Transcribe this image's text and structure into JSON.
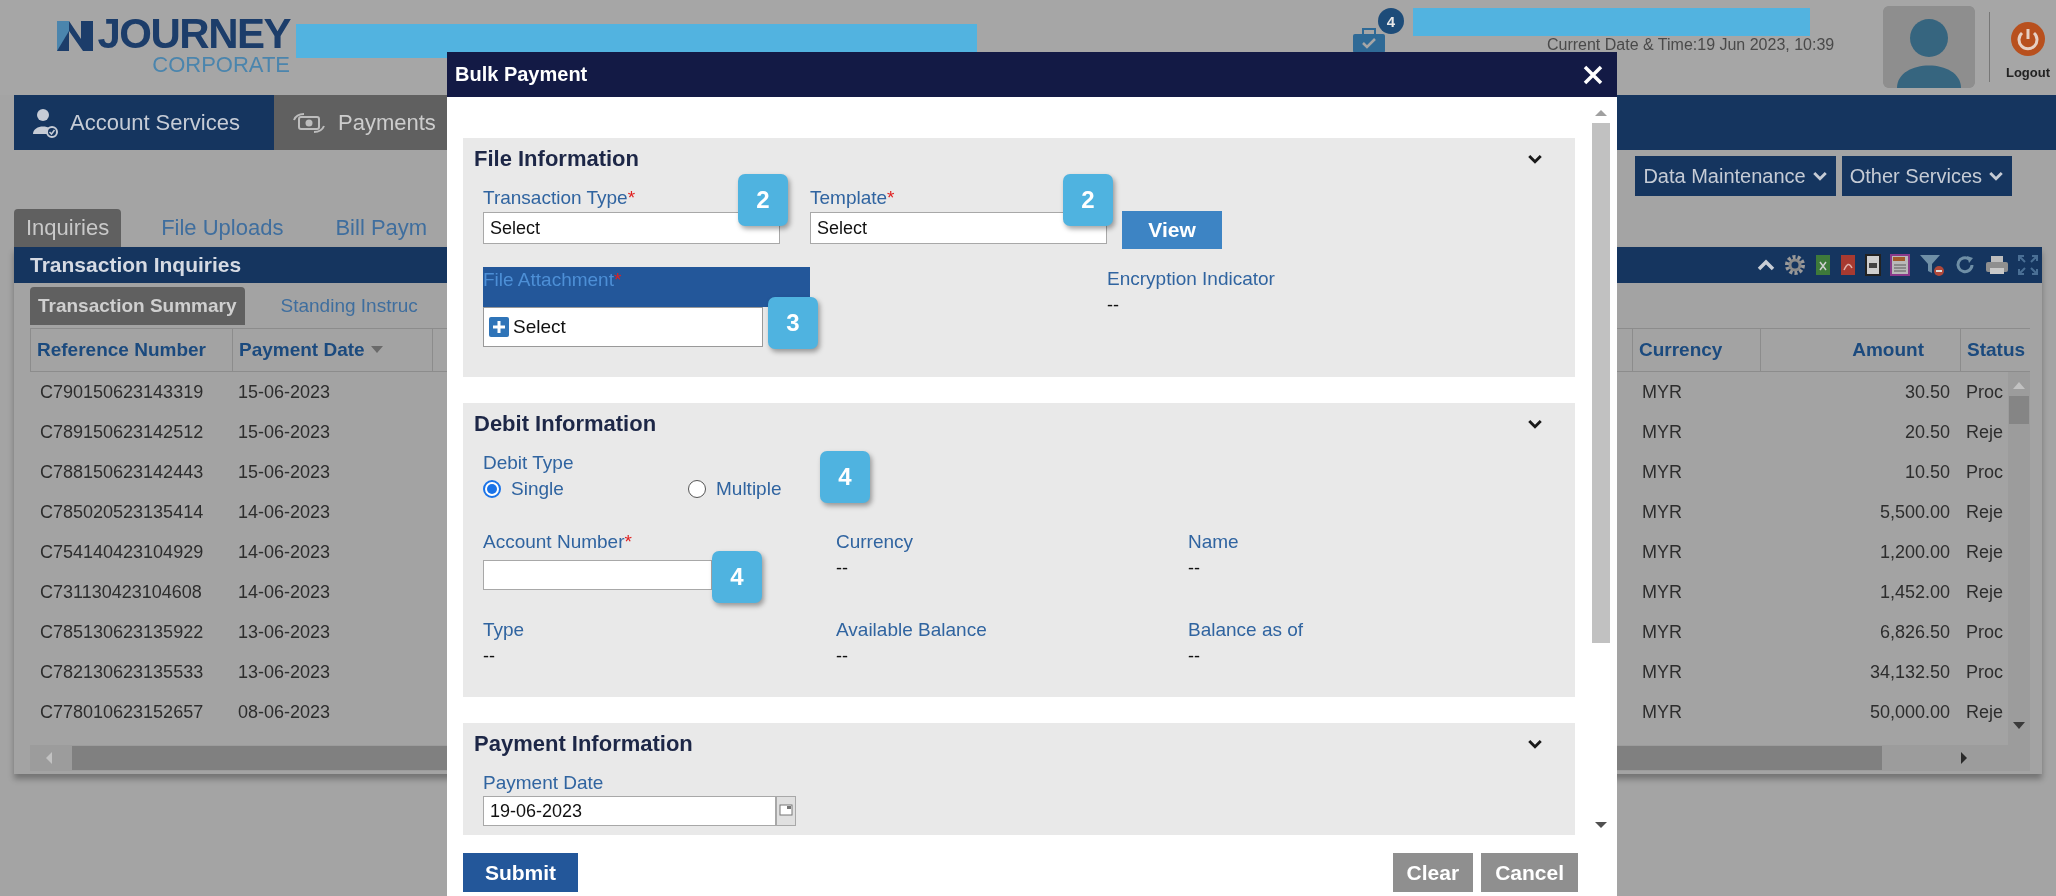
{
  "header": {
    "logo_name": "JOURNEY",
    "logo_tagline": "CORPORATE",
    "notification_count": "4",
    "datetime": "Current Date & Time:19 Jun 2023, 10:39",
    "logout": "Logout"
  },
  "nav": [
    {
      "label": "Account Services",
      "selected": false
    },
    {
      "label": "Payments",
      "selected": true
    }
  ],
  "menus": [
    {
      "label": "Data Maintenance"
    },
    {
      "label": "Other Services"
    }
  ],
  "tabs": [
    {
      "label": "Inquiries",
      "selected": true
    },
    {
      "label": "File Uploads",
      "selected": false
    },
    {
      "label": "Bill Paym",
      "selected": false
    }
  ],
  "panel": {
    "title": "Transaction Inquiries",
    "subtabs": [
      {
        "label": "Transaction Summary",
        "selected": true
      },
      {
        "label": "Standing Instruc",
        "selected": false
      }
    ],
    "table": {
      "columns": [
        {
          "label": "Reference Number",
          "sorted": false
        },
        {
          "label": "Payment Date",
          "sorted": true
        },
        {
          "label": "Currency",
          "sorted": false
        },
        {
          "label": "Amount",
          "sorted": false
        },
        {
          "label": "Status",
          "sorted": false
        }
      ],
      "rows": [
        {
          "reference_number": "C790150623143319",
          "payment_date": "15-06-2023",
          "currency": "MYR",
          "amount": "30.50",
          "status": "Proc"
        },
        {
          "reference_number": "C789150623142512",
          "payment_date": "15-06-2023",
          "currency": "MYR",
          "amount": "20.50",
          "status": "Reje"
        },
        {
          "reference_number": "C788150623142443",
          "payment_date": "15-06-2023",
          "currency": "MYR",
          "amount": "10.50",
          "status": "Proc"
        },
        {
          "reference_number": "C785020523135414",
          "payment_date": "14-06-2023",
          "currency": "MYR",
          "amount": "5,500.00",
          "status": "Reje"
        },
        {
          "reference_number": "C754140423104929",
          "payment_date": "14-06-2023",
          "currency": "MYR",
          "amount": "1,200.00",
          "status": "Reje"
        },
        {
          "reference_number": "C731130423104608",
          "payment_date": "14-06-2023",
          "currency": "MYR",
          "amount": "1,452.00",
          "status": "Reje"
        },
        {
          "reference_number": "C785130623135922",
          "payment_date": "13-06-2023",
          "currency": "MYR",
          "amount": "6,826.50",
          "status": "Proc"
        },
        {
          "reference_number": "C782130623135533",
          "payment_date": "13-06-2023",
          "currency": "MYR",
          "amount": "34,132.50",
          "status": "Proc"
        },
        {
          "reference_number": "C778010623152657",
          "payment_date": "08-06-2023",
          "currency": "MYR",
          "amount": "50,000.00",
          "status": "Reje"
        }
      ]
    }
  },
  "dialog": {
    "title": "Bulk Payment",
    "file_information": {
      "title": "File Information",
      "transaction_type": {
        "label": "Transaction Type",
        "required_mark": "*",
        "value": "Select",
        "step": "2"
      },
      "template": {
        "label": "Template",
        "required_mark": "*",
        "value": "Select",
        "step": "2"
      },
      "view_button": "View",
      "file_attachment": {
        "label": "File Attachment",
        "required_mark": "*",
        "value": "Select",
        "step": "3"
      },
      "encryption_indicator": {
        "label": "Encryption Indicator",
        "value": "--"
      }
    },
    "debit_information": {
      "title": "Debit Information",
      "debit_type": {
        "label": "Debit Type",
        "step": "4",
        "options": [
          {
            "label": "Single",
            "selected": true
          },
          {
            "label": "Multiple",
            "selected": false
          }
        ]
      },
      "account_number": {
        "label": "Account Number",
        "required_mark": "*",
        "step": "4"
      },
      "details": [
        {
          "label": "Currency",
          "value": "--"
        },
        {
          "label": "Name",
          "value": "--"
        },
        {
          "label": "Type",
          "value": "--"
        },
        {
          "label": "Available Balance",
          "value": "--"
        },
        {
          "label": "Balance as of",
          "value": "--"
        }
      ]
    },
    "payment_information": {
      "title": "Payment Information",
      "payment_date": {
        "label": "Payment Date",
        "value": "19-06-2023"
      }
    },
    "buttons": [
      {
        "label": "Submit",
        "kind": "primary"
      },
      {
        "label": "Clear",
        "kind": "secondary"
      },
      {
        "label": "Cancel",
        "kind": "secondary"
      }
    ]
  }
}
